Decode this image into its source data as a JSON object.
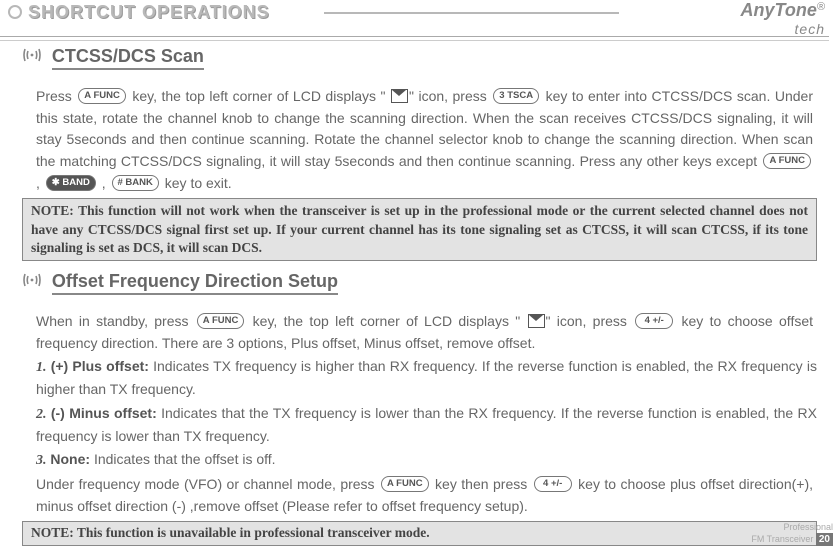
{
  "header": {
    "title": "SHORTCUT OPERATIONS",
    "brand": "AnyTone",
    "brand_sub": "tech",
    "brand_reg": "®"
  },
  "sections": {
    "ctcss": {
      "title": "CTCSS/DCS Scan",
      "para_a": "Press ",
      "para_b": " key, the top left corner of LCD displays \" ",
      "para_c": "\" icon, press ",
      "para_d": " key to enter into CTCSS/DCS scan. Under this state, rotate the channel knob to change the scanning direction. When the scan receives CTCSS/DCS signaling, it will stay 5seconds and then continue scanning. Rotate the channel selector knob to change the scanning direction. When scan the matching CTCSS/DCS signaling, it will stay 5seconds and then continue scanning. Press any other keys except ",
      "para_e": " , ",
      "para_f": " , ",
      "para_g": " key to exit."
    },
    "note1": "NOTE:  This function will not work when the transceiver is set up in the professional mode or the current selected channel does not have any CTCSS/DCS signal first set up. If your current channel has its tone signaling set as CTCSS, it will scan CTCSS, if its tone signaling is set as DCS, it will scan DCS.",
    "offset": {
      "title": "Offset Frequency Direction Setup",
      "intro_a": "When in standby, press ",
      "intro_b": " key, the top left corner of LCD displays \" ",
      "intro_c": "\" icon, press ",
      "intro_d": " key to choose offset frequency direction. There are 3 options, Plus offset, Minus offset, remove offset.",
      "items": [
        {
          "num": "1.",
          "bold": "(+) Plus offset:",
          "rest": " Indicates TX frequency is higher than RX frequency. If the reverse function is enabled, the RX frequency is higher than TX frequency."
        },
        {
          "num": "2.",
          "bold": "(-) Minus offset:",
          "rest": " Indicates that the TX frequency is lower than the RX frequency. If the reverse function is enabled, the RX frequency is lower than TX frequency."
        },
        {
          "num": "3.",
          "bold": "None:",
          "rest": " Indicates that the offset is off."
        }
      ],
      "outro_a": "Under frequency mode (VFO) or channel mode, press ",
      "outro_b": " key then press ",
      "outro_c": " key to choose plus offset direction(+), minus offset direction (-) ,remove offset (Please refer to offset frequency setup)."
    },
    "note2": "NOTE: This function is unavailable in professional transceiver mode."
  },
  "keys": {
    "func": "A FUNC",
    "tsca": "3 TSCA",
    "band": "✱ BAND",
    "bank": "# BANK",
    "fourpm": "4 +/-"
  },
  "footer": {
    "line1": "Professional",
    "line2": "FM Transceiver",
    "page": "20"
  }
}
